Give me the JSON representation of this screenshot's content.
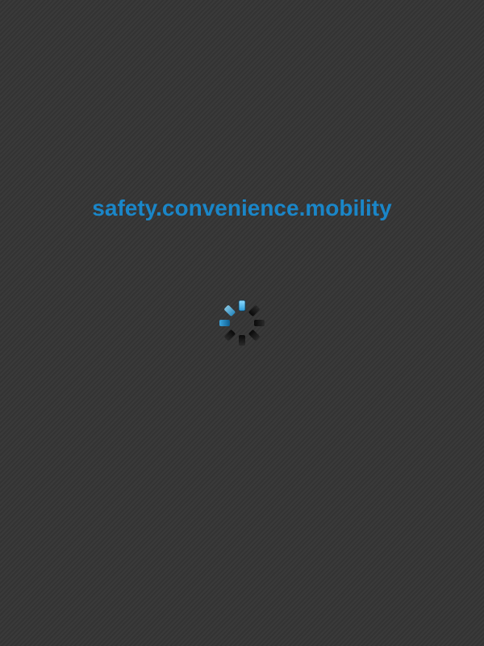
{
  "splash": {
    "tagline": "safety.convenience.mobility"
  },
  "loading_indicator": {
    "icon": "loading-spinner-icon",
    "active_segment_color": "#5bc4f2",
    "trail_segment_color": "#1a86c8",
    "inactive_segment_color": "#111111"
  },
  "colors": {
    "background": "#383838",
    "accent": "#1a86c8"
  }
}
